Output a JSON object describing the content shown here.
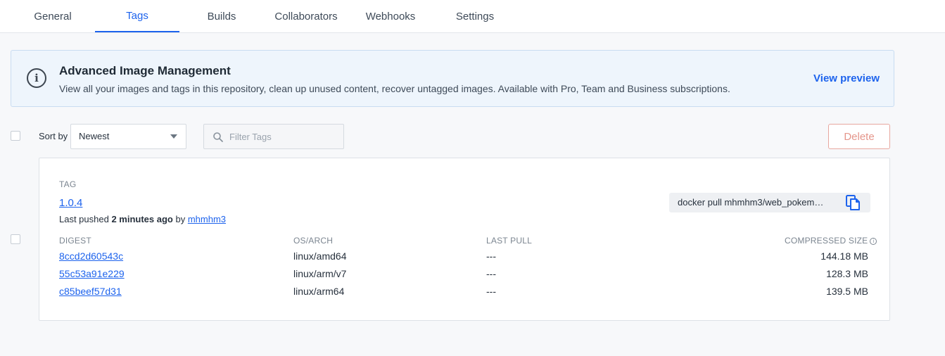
{
  "tabs": [
    {
      "label": "General"
    },
    {
      "label": "Tags",
      "active": true
    },
    {
      "label": "Builds"
    },
    {
      "label": "Collaborators"
    },
    {
      "label": "Webhooks"
    },
    {
      "label": "Settings"
    }
  ],
  "banner": {
    "icon": "info-icon",
    "title": "Advanced Image Management",
    "text": "View all your images and tags in this repository, clean up unused content, recover untagged images. Available with Pro, Team and Business subscriptions.",
    "link": "View preview"
  },
  "toolbar": {
    "sort_label": "Sort by",
    "sort_value": "Newest",
    "filter_placeholder": "Filter Tags",
    "delete_label": "Delete"
  },
  "tag": {
    "header": "TAG",
    "name": "1.0.4",
    "pushed_prefix": "Last pushed ",
    "pushed_time": "2 minutes ago",
    "pushed_by": " by ",
    "pushed_user": "mhmhm3",
    "pull_command": "docker pull mhmhm3/web_pokemo...",
    "columns": {
      "digest": "DIGEST",
      "os_arch": "OS/ARCH",
      "last_pull": "LAST PULL",
      "size": "COMPRESSED SIZE"
    },
    "rows": [
      {
        "digest": "8ccd2d60543c",
        "os_arch": "linux/amd64",
        "last_pull": "---",
        "size": "144.18 MB"
      },
      {
        "digest": "55c53a91e229",
        "os_arch": "linux/arm/v7",
        "last_pull": "---",
        "size": "128.3 MB"
      },
      {
        "digest": "c85beef57d31",
        "os_arch": "linux/arm64",
        "last_pull": "---",
        "size": "139.5 MB"
      }
    ]
  },
  "colors": {
    "accent": "#1d63ed",
    "banner_bg": "#eef5fc",
    "delete": "#e5968b"
  }
}
